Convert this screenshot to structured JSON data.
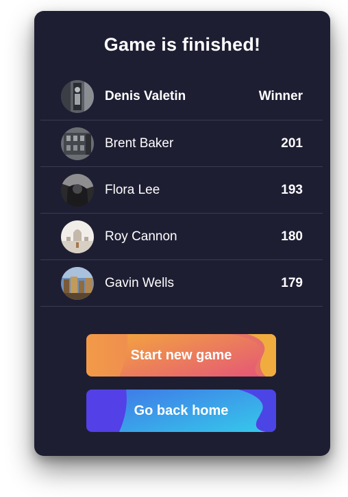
{
  "dialog": {
    "title": "Game is finished!"
  },
  "winner": {
    "name": "Denis Valetin",
    "label": "Winner"
  },
  "players": [
    {
      "name": "Brent Baker",
      "score": "201"
    },
    {
      "name": "Flora Lee",
      "score": "193"
    },
    {
      "name": "Roy Cannon",
      "score": "180"
    },
    {
      "name": "Gavin Wells",
      "score": "179"
    }
  ],
  "buttons": {
    "start_label": "Start new game",
    "home_label": "Go back home"
  },
  "colors": {
    "card_background": "#1e1e33",
    "divider": "#3a3a52",
    "start_gradient": [
      "#f2a640",
      "#e4527a"
    ],
    "home_gradient": [
      "#5b3fe6",
      "#35c6ec"
    ]
  }
}
